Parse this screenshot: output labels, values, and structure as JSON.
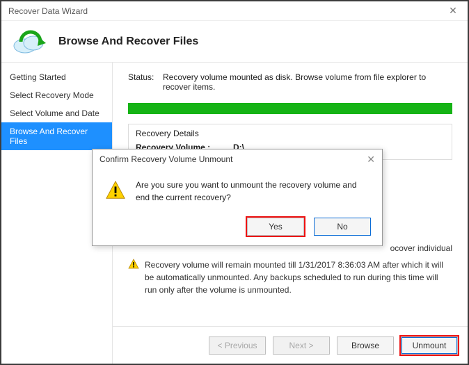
{
  "window": {
    "title": "Recover Data Wizard"
  },
  "header": {
    "title": "Browse And Recover Files"
  },
  "sidebar": {
    "items": [
      {
        "label": "Getting Started"
      },
      {
        "label": "Select Recovery Mode"
      },
      {
        "label": "Select Volume and Date"
      },
      {
        "label": "Browse And Recover Files"
      }
    ]
  },
  "status": {
    "label": "Status:",
    "text": "Recovery volume mounted as disk. Browse volume from file explorer to recover items."
  },
  "details": {
    "title": "Recovery Details",
    "volume_key": "Recovery Volume   :",
    "volume_value": "D:\\"
  },
  "hint": {
    "text": "ocover individual"
  },
  "warning": {
    "text": "Recovery volume will remain mounted till 1/31/2017 8:36:03 AM after which it will be automatically unmounted. Any backups scheduled to run during this time will run only after the volume is unmounted."
  },
  "footer": {
    "previous": "< Previous",
    "next": "Next >",
    "browse": "Browse",
    "unmount": "Unmount"
  },
  "dialog": {
    "title": "Confirm Recovery Volume Unmount",
    "message": "Are you sure you want to unmount the recovery volume and end the current recovery?",
    "yes": "Yes",
    "no": "No"
  }
}
